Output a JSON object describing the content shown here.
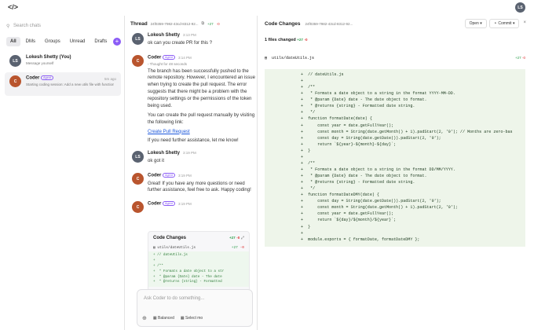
{
  "app": {
    "logo": "</>",
    "user_initials": "LS"
  },
  "sidebar": {
    "search_placeholder": "Search chats",
    "filters": [
      "All",
      "DMs",
      "Groups",
      "Unread",
      "Drafts"
    ],
    "chats": [
      {
        "initials": "LS",
        "name": "Lokesh Shetty (You)",
        "subtitle": "Message yourself",
        "time": ""
      },
      {
        "initials": "C",
        "name": "Coder",
        "badge": "Agent",
        "subtitle": "Starting coding session: Add a new utils file with function...",
        "time": "5m ago"
      }
    ]
  },
  "thread": {
    "title": "Thread",
    "session_id": "24f0359-7982-43cd-8312-92...",
    "additions": "+27",
    "deletions": "-0",
    "messages": [
      {
        "initials": "LS",
        "author": "Lokesh Shetty",
        "time": "3:13 PM",
        "text": "ok can you create PR for this ?"
      },
      {
        "initials": "C",
        "author": "Coder",
        "badge": "Agent",
        "time": "3:14 PM",
        "thought": "Thought for 48 seconds",
        "p1": "The branch has been successfully pushed to the remote repository. However, I encountered an issue when trying to create the pull request. The error suggests that there might be a problem with the repository settings or the permissions of the token being used.",
        "p2": "You can create the pull request manually by visiting the following link:",
        "link": "Create Pull Request",
        "p3": "If you need further assistance, let me know!"
      },
      {
        "initials": "LS",
        "author": "Lokesh Shetty",
        "time": "3:19 PM",
        "text": "ok got it"
      },
      {
        "initials": "C",
        "author": "Coder",
        "badge": "Agent",
        "time": "3:19 PM",
        "text": "Great! If you have any more questions or need further assistance, feel free to ask. Happy coding!"
      },
      {
        "initials": "C",
        "author": "Coder",
        "badge": "Agent",
        "time": "3:19 PM"
      }
    ],
    "card": {
      "title": "Code Changes",
      "additions": "+27",
      "deletions": "-0",
      "file": "utils/dateUtils.js",
      "file_add": "+27",
      "file_del": "-0",
      "code": "+ // dateUtils.js\n+\n+ /**\n+  * Formats a date object to a str\n+  * @param {Date} date - The date\n+  * @returns {string} - Formatted"
    },
    "composer": {
      "placeholder": "Ask Coder to do something...",
      "mode": "Balanced",
      "model": "Select mo"
    }
  },
  "changes": {
    "title": "Code Changes",
    "session_id": "24f0359-7982-43cd-8312-92...",
    "open_label": "Open",
    "commit_label": "Commit",
    "files_changed": "1 files changed",
    "additions": "+27",
    "deletions": "-0",
    "file": "utils/dateUtils.js",
    "code": "+  // dateUtils.js\n+\n+  /**\n+   * Formats a date object to a string in the format YYYY-MM-DD.\n+   * @param {Date} date - The date object to format.\n+   * @returns {string} - Formatted date string.\n+   */\n+  function formatDate(date) {\n+      const year = date.getFullYear();\n+      const month = String(date.getMonth() + 1).padStart(2, '0'); // Months are zero-bas\n+      const day = String(date.getDate()).padStart(2, '0');\n+      return `${year}-${month}-${day}`;\n+  }\n+\n+  /**\n+   * Formats a date object to a string in the format DD/MM/YYYY.\n+   * @param {Date} date - The date object to format.\n+   * @returns {string} - Formatted date string.\n+   */\n+  function formatDateDMY(date) {\n+      const day = String(date.getDate()).padStart(2, '0');\n+      const month = String(date.getMonth() + 1).padStart(2, '0');\n+      const year = date.getFullYear();\n+      return `${day}/${month}/${year}`;\n+  }\n+\n+  module.exports = { formatDate, formatDateDMY };"
  }
}
